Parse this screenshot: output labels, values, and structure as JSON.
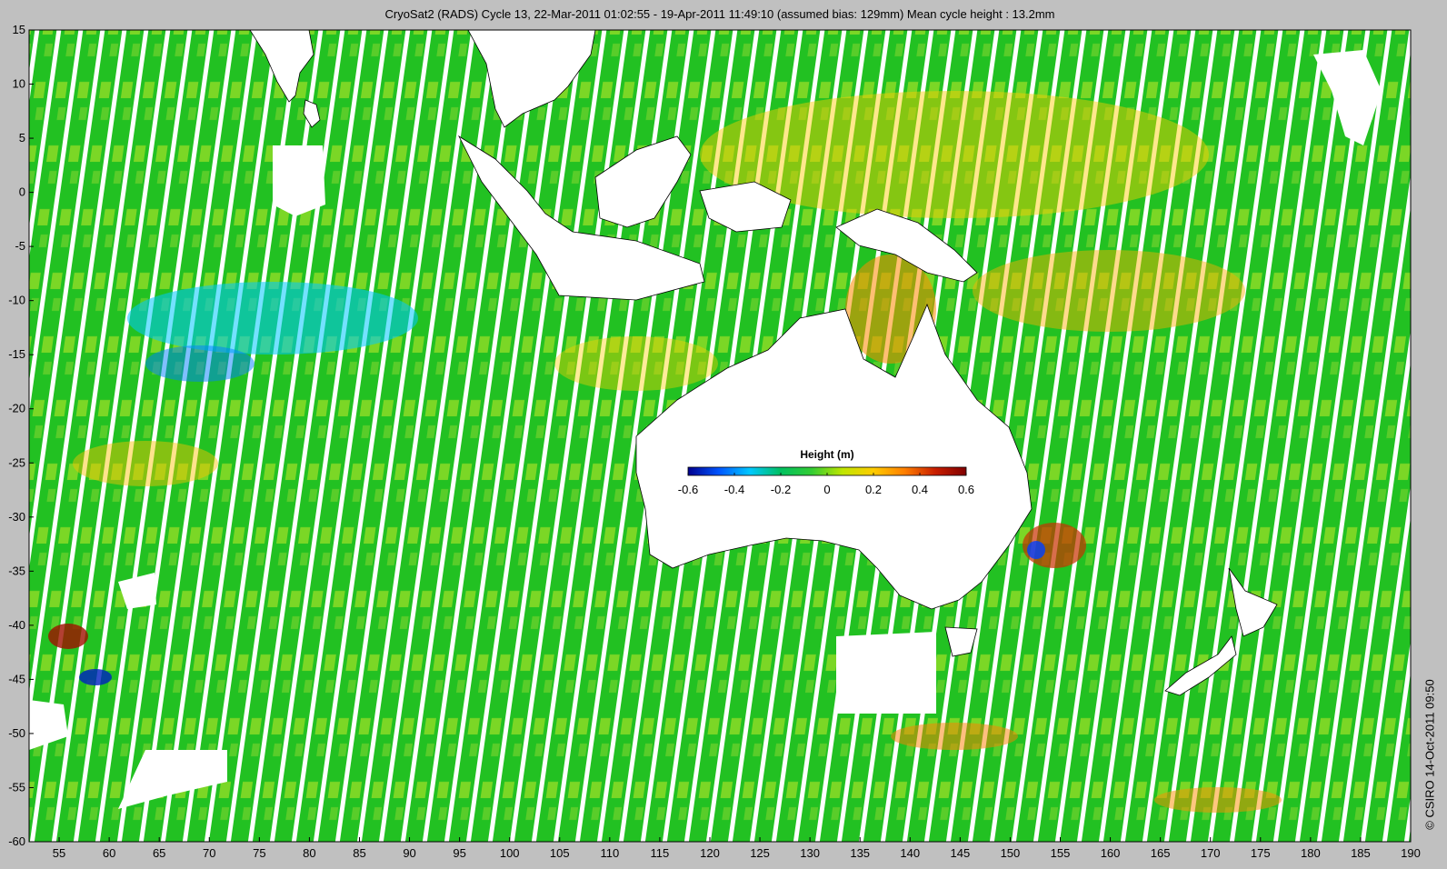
{
  "header": {
    "title": "CryoSat2 (RADS) Cycle 13, 22-Mar-2011 01:02:55 - 19-Apr-2011 11:49:10 (assumed bias: 129mm)  Mean cycle height : 13.2mm"
  },
  "credit": "© CSIRO 14-Oct-2011 09:50",
  "map": {
    "projection": "equirectangular",
    "lon_range": [
      52,
      190
    ],
    "lat_range": [
      -60,
      15
    ],
    "x_ticks": [
      "55",
      "60",
      "65",
      "70",
      "75",
      "80",
      "85",
      "90",
      "95",
      "100",
      "105",
      "110",
      "115",
      "120",
      "125",
      "130",
      "135",
      "140",
      "145",
      "150",
      "155",
      "160",
      "165",
      "170",
      "175",
      "180",
      "185",
      "190"
    ],
    "y_ticks": [
      "15",
      "10",
      "5",
      "0",
      "-5",
      "-10",
      "-15",
      "-20",
      "-25",
      "-30",
      "-35",
      "-40",
      "-45",
      "-50",
      "-55",
      "-60"
    ],
    "variable": "sea surface height anomaly",
    "land_color": "#ffffff",
    "coastline_color": "#000000",
    "background_color": "#c0c0c0",
    "colormap_stops": [
      "#00008f",
      "#0055ff",
      "#00c8ff",
      "#00c060",
      "#33cc33",
      "#bfe600",
      "#ffcc00",
      "#ff7f00",
      "#c81e00",
      "#800000"
    ]
  },
  "colorbar": {
    "title": "Height (m)",
    "range": [
      -0.6,
      0.6
    ],
    "tick_labels": [
      "-0.6",
      "-0.4",
      "-0.2",
      "0",
      "0.2",
      "0.4",
      "0.6"
    ]
  }
}
